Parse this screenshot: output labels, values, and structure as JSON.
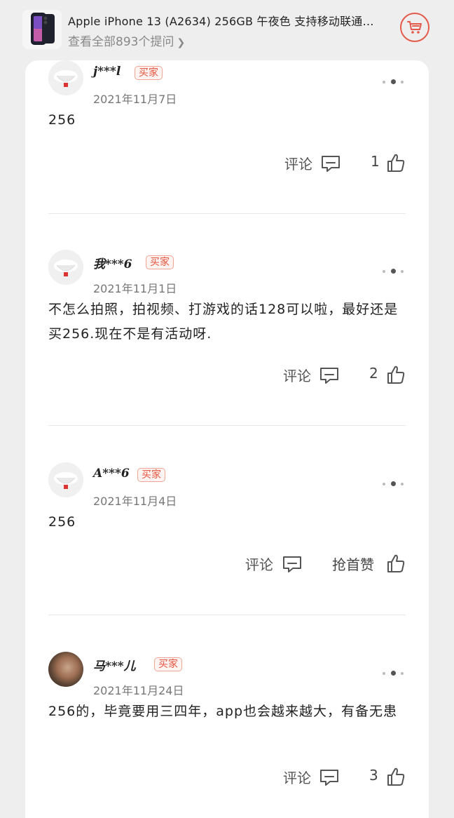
{
  "header": {
    "product_title": "Apple iPhone 13 (A2634) 256GB 午夜色 支持移动联通…",
    "ask_link": "查看全部893个提问",
    "ask_chevron": "❯"
  },
  "reviews": [
    {
      "name": "j***l",
      "badge": "买家",
      "date": "2021年11月7日",
      "text": "256",
      "comment_label": "评论",
      "like_count": "1"
    },
    {
      "name": "我***6",
      "badge": "买家",
      "date": "2021年11月1日",
      "text": "不怎么拍照，拍视频、打游戏的话128可以啦，最好还是买256.现在不是有活动呀.",
      "comment_label": "评论",
      "like_count": "2"
    },
    {
      "name": "A***6",
      "badge": "买家",
      "date": "2021年11月4日",
      "text": "256",
      "comment_label": "评论",
      "like_count": "抢首赞"
    },
    {
      "name": "马***儿",
      "badge": "买家",
      "date": "2021年11月24日",
      "text": "256的，毕竟要用三四年，app也会越来越大，有备无患",
      "comment_label": "评论",
      "like_count": "3"
    }
  ],
  "colors": {
    "accent": "#e4553f",
    "background": "#eeeeee",
    "card": "#ffffff"
  }
}
